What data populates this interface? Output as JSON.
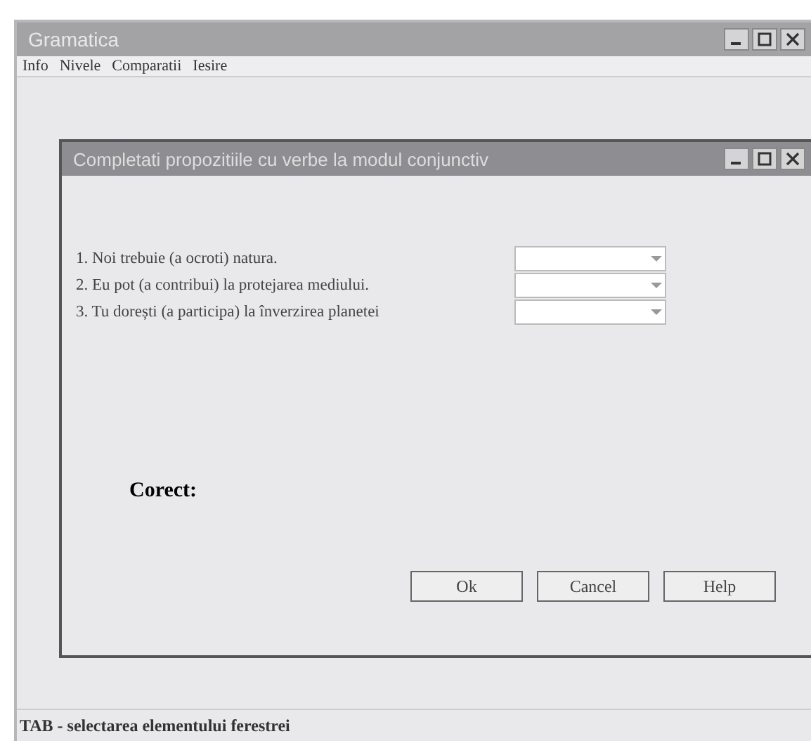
{
  "window": {
    "title": "Gramatica"
  },
  "menu": [
    "Info",
    "Nivele",
    "Comparatii",
    "Iesire"
  ],
  "dialog": {
    "title": "Completati propozitiile cu verbe la modul conjunctiv",
    "sentences": [
      {
        "text": "1. Noi trebuie (a ocroti) natura."
      },
      {
        "text": "2. Eu pot (a contribui) la protejarea mediului."
      },
      {
        "text": "3. Tu dorești (a participa) la înverzirea planetei"
      }
    ],
    "result_label": "Corect:",
    "buttons": [
      "Ok",
      "Cancel",
      "Help"
    ]
  },
  "status_bar": "TAB - selectarea elementului ferestrei"
}
